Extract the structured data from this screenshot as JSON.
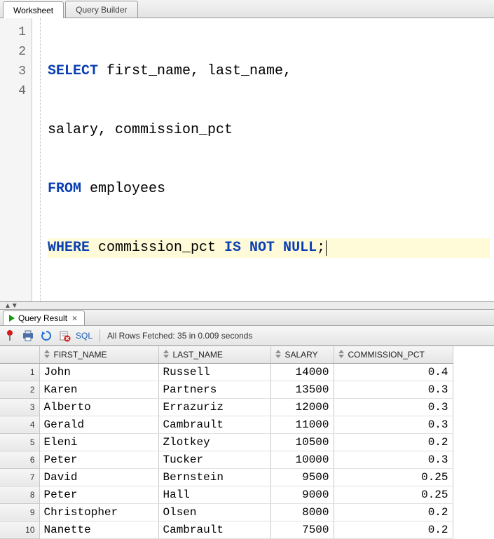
{
  "top_tabs": {
    "worksheet": "Worksheet",
    "query_builder": "Query Builder"
  },
  "editor": {
    "lines": [
      "1",
      "2",
      "3",
      "4"
    ],
    "sql": {
      "l1_kw": "SELECT",
      "l1_rest": " first_name, last_name,",
      "l2": "salary, commission_pct",
      "l3_kw": "FROM",
      "l3_rest": " employees",
      "l4_kw1": "WHERE",
      "l4_mid": " commission_pct ",
      "l4_kw2": "IS NOT NULL",
      "l4_end": ";"
    }
  },
  "result_tab": {
    "label": "Query Result",
    "close": "×"
  },
  "toolbar": {
    "sql_link": "SQL",
    "status": "All Rows Fetched: 35 in 0.009 seconds"
  },
  "columns": {
    "first": "FIRST_NAME",
    "last": "LAST_NAME",
    "salary": "SALARY",
    "commission": "COMMISSION_PCT"
  },
  "rows": [
    {
      "n": "1",
      "first": "John",
      "last": "Russell",
      "salary": "14000",
      "commission": "0.4"
    },
    {
      "n": "2",
      "first": "Karen",
      "last": "Partners",
      "salary": "13500",
      "commission": "0.3"
    },
    {
      "n": "3",
      "first": "Alberto",
      "last": "Errazuriz",
      "salary": "12000",
      "commission": "0.3"
    },
    {
      "n": "4",
      "first": "Gerald",
      "last": "Cambrault",
      "salary": "11000",
      "commission": "0.3"
    },
    {
      "n": "5",
      "first": "Eleni",
      "last": "Zlotkey",
      "salary": "10500",
      "commission": "0.2"
    },
    {
      "n": "6",
      "first": "Peter",
      "last": "Tucker",
      "salary": "10000",
      "commission": "0.3"
    },
    {
      "n": "7",
      "first": "David",
      "last": "Bernstein",
      "salary": "9500",
      "commission": "0.25"
    },
    {
      "n": "8",
      "first": "Peter",
      "last": "Hall",
      "salary": "9000",
      "commission": "0.25"
    },
    {
      "n": "9",
      "first": "Christopher",
      "last": "Olsen",
      "salary": "8000",
      "commission": "0.2"
    },
    {
      "n": "10",
      "first": "Nanette",
      "last": "Cambrault",
      "salary": "7500",
      "commission": "0.2"
    }
  ]
}
